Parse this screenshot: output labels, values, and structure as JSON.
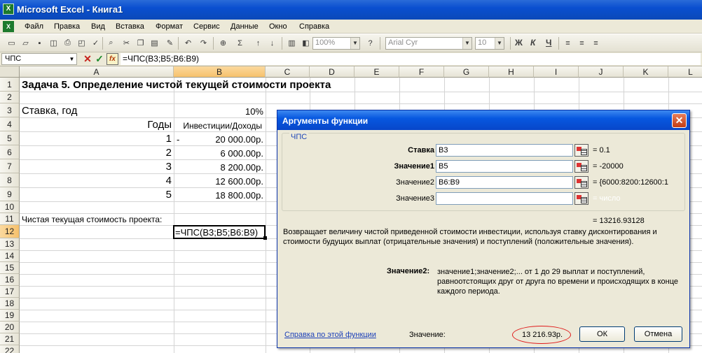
{
  "window": {
    "title": "Microsoft Excel - Книга1"
  },
  "menu": [
    "Файл",
    "Правка",
    "Вид",
    "Вставка",
    "Формат",
    "Сервис",
    "Данные",
    "Окно",
    "Справка"
  ],
  "toolbar": {
    "zoom": "100%",
    "font": "Arial Cyr",
    "size": "10",
    "bold": "Ж",
    "italic": "К",
    "underline": "Ч",
    "autosum": "Σ"
  },
  "formula_bar": {
    "name_box": "ЧПС",
    "cancel": "✕",
    "enter": "✓",
    "fx": "fx",
    "formula": "=ЧПС(B3;B5;B6:B9)"
  },
  "columns": [
    "A",
    "B",
    "C",
    "D",
    "E",
    "F",
    "G",
    "H",
    "I",
    "J",
    "K",
    "L"
  ],
  "rows": [
    "1",
    "2",
    "3",
    "4",
    "5",
    "6",
    "7",
    "8",
    "9",
    "10",
    "11",
    "12",
    "13",
    "14",
    "15",
    "16",
    "17",
    "18",
    "19",
    "20",
    "21",
    "22"
  ],
  "sheet": {
    "a1": "Задача 5. Определение чистой текущей стоимости проекта",
    "a3": "Ставка, год",
    "b3": "10%",
    "a4": "Годы",
    "b4": "Инвестиции/Доходы",
    "a5": "1",
    "b5_sign": "-",
    "b5": "20 000.00р.",
    "a6": "2",
    "b6": "6 000.00р.",
    "a7": "3",
    "b7": "8 200.00р.",
    "a8": "4",
    "b8": "12 600.00р.",
    "a9": "5",
    "b9": "18 800.00р.",
    "a11": "Чистая текущая стоимость проекта:",
    "b12": "=ЧПС(B3;B5;B6:B9)"
  },
  "dialog": {
    "title": "Аргументы функции",
    "close": "✕",
    "function_name": "ЧПС",
    "args": [
      {
        "label": "Ставка",
        "value": "B3",
        "result": "= 0.1"
      },
      {
        "label": "Значение1",
        "value": "B5",
        "result": "= -20000"
      },
      {
        "label": "Значение2",
        "value": "B6:B9",
        "result": "= {6000:8200:12600:1"
      },
      {
        "label": "Значение3",
        "value": "",
        "result": "= число"
      }
    ],
    "result_top": "= 13216.93128",
    "description": "Возвращает величину чистой приведенной стоимости инвестиции, используя ставку дисконтирования и стоимости будущих выплат (отрицательные значения) и поступлений (положительные значения).",
    "arg_help_label": "Значение2:",
    "arg_help": "значение1;значение2;... от 1 до 29 выплат и поступлений, равноотстоящих друг от друга по времени и происходящих в конце каждого периода.",
    "help_link": "Справка по этой функции",
    "value_label": "Значение:",
    "value": "13 216.93р.",
    "ok": "ОК",
    "cancel": "Отмена"
  }
}
